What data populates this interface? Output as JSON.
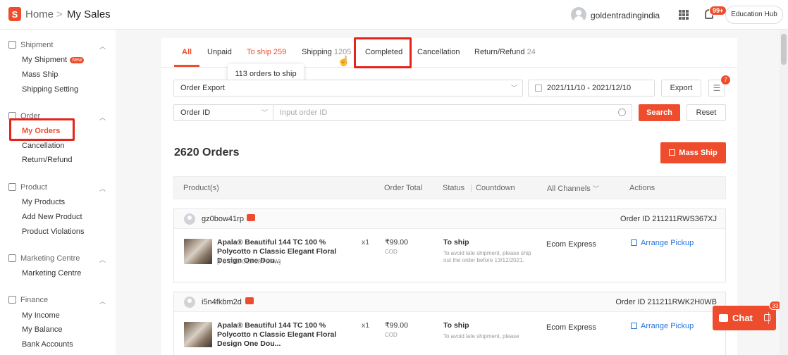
{
  "header": {
    "logo": "S",
    "breadcrumb_home": "Home",
    "breadcrumb_sep": ">",
    "breadcrumb_current": "My Sales",
    "username": "goldentradingindia",
    "notification_badge": "99+",
    "education_hub": "Education Hub"
  },
  "sidebar": {
    "shipment": {
      "label": "Shipment",
      "items": [
        "My Shipment",
        "Mass Ship",
        "Shipping Setting"
      ],
      "new_badge": "New"
    },
    "order": {
      "label": "Order",
      "items": [
        "My Orders",
        "Cancellation",
        "Return/Refund"
      ]
    },
    "product": {
      "label": "Product",
      "items": [
        "My Products",
        "Add New Product",
        "Product Violations"
      ]
    },
    "marketing": {
      "label": "Marketing Centre",
      "items": [
        "Marketing Centre"
      ]
    },
    "finance": {
      "label": "Finance",
      "items": [
        "My Income",
        "My Balance",
        "Bank Accounts"
      ]
    }
  },
  "tabs": {
    "all": "All",
    "unpaid": "Unpaid",
    "to_ship": "To ship",
    "to_ship_count": "259",
    "shipping": "Shipping",
    "shipping_count": "1205",
    "completed": "Completed",
    "cancellation": "Cancellation",
    "return_refund": "Return/Refund",
    "return_count": "24"
  },
  "tooltip": "113 orders to ship",
  "filters": {
    "export_select": "Order Export",
    "date_range": "2021/11/10 - 2021/12/10",
    "export_btn": "Export",
    "list_badge": "7",
    "search_type": "Order ID",
    "search_placeholder": "Input order ID",
    "search_btn": "Search",
    "reset_btn": "Reset"
  },
  "orders_title": "2620 Orders",
  "mass_ship": "Mass Ship",
  "table_headers": {
    "product": "Product(s)",
    "total": "Order Total",
    "status": "Status",
    "countdown": "Countdown",
    "channels": "All Channels",
    "actions": "Actions"
  },
  "orders": [
    {
      "buyer": "gz0bow41rp",
      "order_id": "Order ID 211211RWS367XJ",
      "product_name": "Apala® Beautiful 144 TC 100 % Polycotto n Classic Elegant Floral Design One Dou...",
      "sku": "[PC-DBS-CLS-084-BRW]",
      "qty": "x1",
      "price": "₹99.00",
      "payment": "COD",
      "status": "To ship",
      "status_note": "To avoid late shipment, please ship out the order before 13/12/2021.",
      "channel": "Ecom Express",
      "action": "Arrange Pickup"
    },
    {
      "buyer": "i5n4fkbm2d",
      "order_id": "Order ID 211211RWK2H0WB",
      "product_name": "Apala® Beautiful 144 TC 100 % Polycotto n Classic Elegant Floral Design One Dou...",
      "qty": "x1",
      "price": "₹99.00",
      "payment": "COD",
      "status": "To ship",
      "status_note": "To avoid late shipment, please",
      "channel": "Ecom Express",
      "action": "Arrange Pickup"
    }
  ],
  "chat": {
    "label": "Chat",
    "badge": "33"
  },
  "colors": {
    "brand": "#ee4d2d",
    "link": "#2673dd",
    "highlight": "#e5231a"
  }
}
